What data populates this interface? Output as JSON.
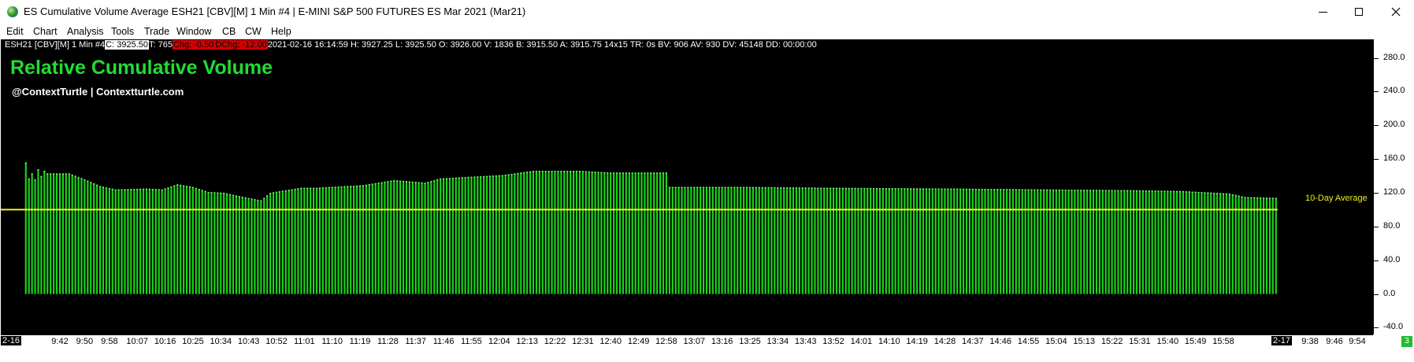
{
  "window": {
    "title": "ES Cumulative Volume Average ESH21 [CBV][M]  1 Min   #4 | E-MINI S&P 500 FUTURES ES Mar 2021 (Mar21)",
    "minimize_glyph": "—",
    "close_glyph": "✕"
  },
  "menu": {
    "items": [
      "Edit",
      "Chart",
      "Analysis",
      "Tools",
      "Trade",
      "Window",
      "CB",
      "CW",
      "Help"
    ]
  },
  "info_line": {
    "symbol": "ESH21 [CBV][M]  1 Min   #4 ",
    "close": "C: 3925.50",
    "ticks": " T: 765 ",
    "change": "Chg: -0.50",
    "daily_change": "DChg: -12.00",
    "rest": " 2021-02-16 16:14:59 H: 3927.25 L: 3925.50 O: 3926.00 V: 1836 B: 3915.50 A: 3915.75 14x15 TR: 0s BV: 906 AV: 930 DV: 45148 DD: 00:00:00"
  },
  "study": {
    "title": "Relative Cumulative Volume",
    "subtitle": "@ContextTurtle | Contextturtle.com",
    "average_label": "10-Day Average"
  },
  "colors": {
    "bar": "#19d619",
    "bar_edge": "#7cf07c",
    "average_line": "#f0f020",
    "background": "#000000",
    "label_green": "#22dd33",
    "badge": "#22bb33"
  },
  "time_axis": {
    "left_date": "2-16",
    "right_date": "2-17",
    "labels": [
      "9:42",
      "9:50",
      "9:58",
      "10:07",
      "10:16",
      "10:25",
      "10:34",
      "10:43",
      "10:52",
      "11:01",
      "11:10",
      "11:19",
      "11:28",
      "11:37",
      "11:46",
      "11:55",
      "12:04",
      "12:13",
      "12:22",
      "12:31",
      "12:40",
      "12:49",
      "12:58",
      "13:07",
      "13:16",
      "13:25",
      "13:34",
      "13:43",
      "13:52",
      "14:01",
      "14:10",
      "14:19",
      "14:28",
      "14:37",
      "14:46",
      "14:55",
      "15:04",
      "15:13",
      "15:22",
      "15:31",
      "15:40",
      "15:49",
      "15:58"
    ],
    "right_labels": [
      "9:38",
      "9:46",
      "9:54"
    ],
    "badge": "3"
  },
  "chart_data": {
    "type": "bar",
    "title": "Relative Cumulative Volume",
    "xlabel": "",
    "ylabel": "",
    "ylim": [
      -48,
      302
    ],
    "y_ticks": [
      "280.0",
      "240.0",
      "200.0",
      "160.0",
      "120.0",
      "80.0",
      "40.0",
      "0.0",
      "-40.0"
    ],
    "y_tick_values": [
      280,
      240,
      200,
      160,
      120,
      80,
      40,
      0,
      -40
    ],
    "average_line": 100,
    "grid": false,
    "x_start": "09:31",
    "x_end": "16:15",
    "bar_interval_minutes": 1,
    "anchors": [
      [
        "09:31",
        156
      ],
      [
        "09:32",
        137
      ],
      [
        "09:33",
        143
      ],
      [
        "09:34",
        136
      ],
      [
        "09:35",
        148
      ],
      [
        "09:36",
        140
      ],
      [
        "09:37",
        146
      ],
      [
        "09:38",
        143
      ],
      [
        "09:45",
        143
      ],
      [
        "09:50",
        136
      ],
      [
        "09:55",
        128
      ],
      [
        "10:00",
        124
      ],
      [
        "10:10",
        125
      ],
      [
        "10:15",
        124
      ],
      [
        "10:20",
        130
      ],
      [
        "10:25",
        127
      ],
      [
        "10:30",
        121
      ],
      [
        "10:35",
        120
      ],
      [
        "10:40",
        116
      ],
      [
        "10:47",
        111
      ],
      [
        "10:50",
        120
      ],
      [
        "10:55",
        123
      ],
      [
        "11:00",
        126
      ],
      [
        "11:05",
        126
      ],
      [
        "11:20",
        129
      ],
      [
        "11:30",
        135
      ],
      [
        "11:40",
        132
      ],
      [
        "11:45",
        137
      ],
      [
        "11:55",
        139
      ],
      [
        "12:05",
        141
      ],
      [
        "12:15",
        146
      ],
      [
        "12:30",
        146
      ],
      [
        "12:40",
        144
      ],
      [
        "12:58",
        144
      ],
      [
        "12:59",
        127
      ],
      [
        "13:20",
        127
      ],
      [
        "13:50",
        126
      ],
      [
        "14:30",
        125
      ],
      [
        "15:00",
        124
      ],
      [
        "15:30",
        123
      ],
      [
        "15:45",
        122
      ],
      [
        "15:55",
        120
      ],
      [
        "16:00",
        119
      ],
      [
        "16:05",
        115
      ],
      [
        "16:15",
        114
      ]
    ]
  }
}
